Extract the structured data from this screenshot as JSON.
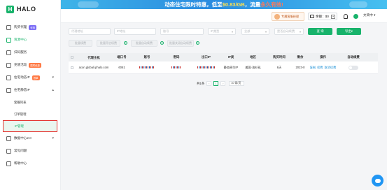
{
  "brand": {
    "logo_letter": "H",
    "name": "HALO"
  },
  "banner": {
    "text_prefix": "动态住宅限时特惠，低至",
    "price": "$0.83/GB",
    "text_mid": "，流量",
    "highlight": "永久有效!"
  },
  "header": {
    "customer_service": "专属客服经理",
    "balance_label": "余额：",
    "balance_value": "$0",
    "add": "+",
    "language": "简中"
  },
  "sidebar": {
    "items": [
      {
        "label": "购买代理",
        "badge": "优惠",
        "badge_color": "#7b6cf6"
      },
      {
        "label": "资源中心",
        "active": true
      },
      {
        "label": "扫码服务"
      },
      {
        "label": "充值活动",
        "badge": "限时优惠",
        "badge_color": "#ff7a45"
      },
      {
        "label": "住宅动态IP",
        "badge": "首单",
        "badge_color": "#ff7a45",
        "chevron": "▾"
      },
      {
        "label": "住宅静态IP",
        "chevron": "▴"
      }
    ],
    "subitems": [
      {
        "label": "套餐列表"
      },
      {
        "label": "订单管理"
      },
      {
        "label": "IP管理",
        "selected": true
      }
    ],
    "bottom_items": [
      {
        "label": "数据中心2.0",
        "chevron": "▾"
      },
      {
        "label": "常见问题"
      },
      {
        "label": "帮助中心"
      }
    ]
  },
  "filters": {
    "proxy_host_placeholder": "代理地址",
    "ip_placeholder": "IP地址",
    "account_placeholder": "账号",
    "ip_type": "IP类型",
    "region": "全部",
    "auto_renew": "是否自动续费",
    "search_button": "查 询",
    "export_button": "导出",
    "batch_renew": "批量续费",
    "batch_open_renew": "批量开启续费",
    "batch_auto_renew": "批量自动续费",
    "batch_close_renew": "批量关闭自动续费"
  },
  "table": {
    "headers": [
      "代理主机",
      "端口号",
      "账号",
      "密码",
      "出口IP",
      "IP类",
      "地区",
      "购买时间",
      "剩余",
      "操作",
      "自动续费"
    ],
    "rows": [
      {
        "host": "acon.global.iphalo.com",
        "port": "6061",
        "ip_type": "静态原生IP",
        "region": "美国·洛杉矶",
        "purchase_time": "6天",
        "remaining": "2023-0",
        "op_copy": "复制",
        "op_renew": "续费",
        "op_cancel": "取消续费"
      }
    ]
  },
  "pager": {
    "total": "共1条",
    "prev": "‹",
    "current": "1",
    "next": "›",
    "page_size": "10 条/页"
  }
}
